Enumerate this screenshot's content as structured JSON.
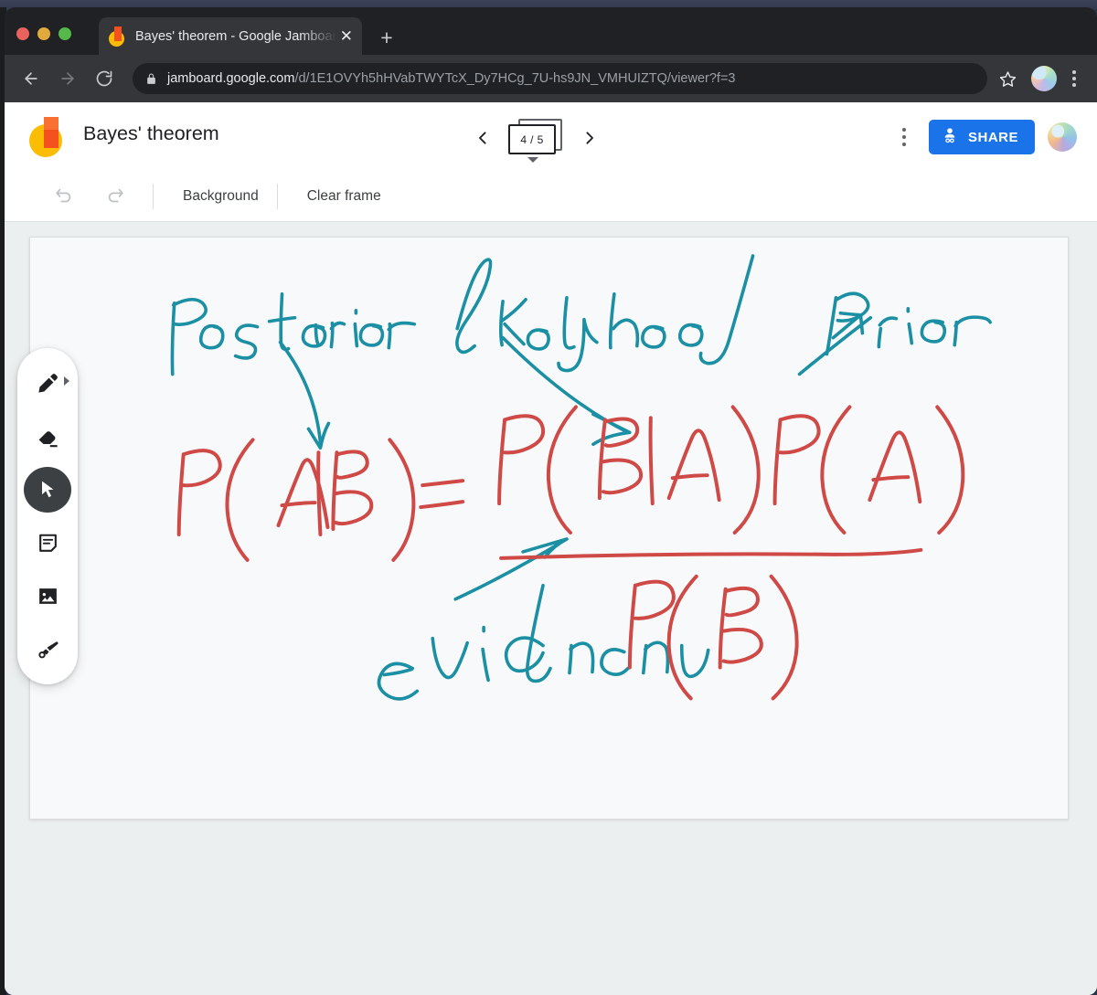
{
  "browser": {
    "tab": {
      "title": "Bayes' theorem - Google Jamboard",
      "favicon_name": "jamboard-favicon",
      "close_label": "✕"
    },
    "new_tab_label": "+",
    "nav": {
      "back_label": "back-arrow",
      "forward_label": "forward-arrow",
      "reload_label": "reload"
    },
    "omnibox": {
      "host": "jamboard.google.com",
      "path": "/d/1E1OVYh5hHVabTWYTcX_Dy7HCg_7U-hs9JN_VMHUIZTQ/viewer?f=3",
      "lock_icon": "lock-icon"
    },
    "bookmark_icon": "star-icon",
    "profile_icon": "profile-avatar",
    "menu_icon": "three-dot-menu-icon"
  },
  "app": {
    "logo_name": "jamboard-logo",
    "title": "Bayes' theorem",
    "frame_nav": {
      "prev_label": "‹",
      "next_label": "›",
      "counter": "4 / 5"
    },
    "overflow_icon": "three-dot-menu-icon",
    "share_label": "SHARE",
    "share_color": "#1a73e8",
    "avatar_name": "user-avatar"
  },
  "toolbar": {
    "undo_icon": "undo-icon",
    "redo_icon": "redo-icon",
    "background_label": "Background",
    "clear_frame_label": "Clear frame"
  },
  "tools": [
    {
      "name": "pen-tool",
      "label": "Pen",
      "active": false,
      "has_caret": true
    },
    {
      "name": "eraser-tool",
      "label": "Eraser",
      "active": false,
      "has_caret": false
    },
    {
      "name": "select-tool",
      "label": "Select",
      "active": true,
      "has_caret": false
    },
    {
      "name": "sticky-note-tool",
      "label": "Sticky note",
      "active": false,
      "has_caret": false
    },
    {
      "name": "image-tool",
      "label": "Image",
      "active": false,
      "has_caret": false
    },
    {
      "name": "laser-tool",
      "label": "Laser pointer",
      "active": false,
      "has_caret": false
    }
  ],
  "canvas": {
    "background": "#f8f9fa",
    "ink_colors": {
      "teal": "#1b8fa3",
      "red": "#cf4a47"
    },
    "annotations": [
      {
        "text": "Posterior",
        "color": "teal",
        "role": "label"
      },
      {
        "text": "likelyhood",
        "color": "teal",
        "role": "label"
      },
      {
        "text": "prior",
        "color": "teal",
        "role": "label"
      },
      {
        "text": "evidence",
        "color": "teal",
        "role": "label"
      }
    ],
    "formula": {
      "left_side": "P(A|B)",
      "equals": "=",
      "numerator": "P(B|A) P(A)",
      "denominator": "P(B)",
      "color": "red"
    }
  }
}
